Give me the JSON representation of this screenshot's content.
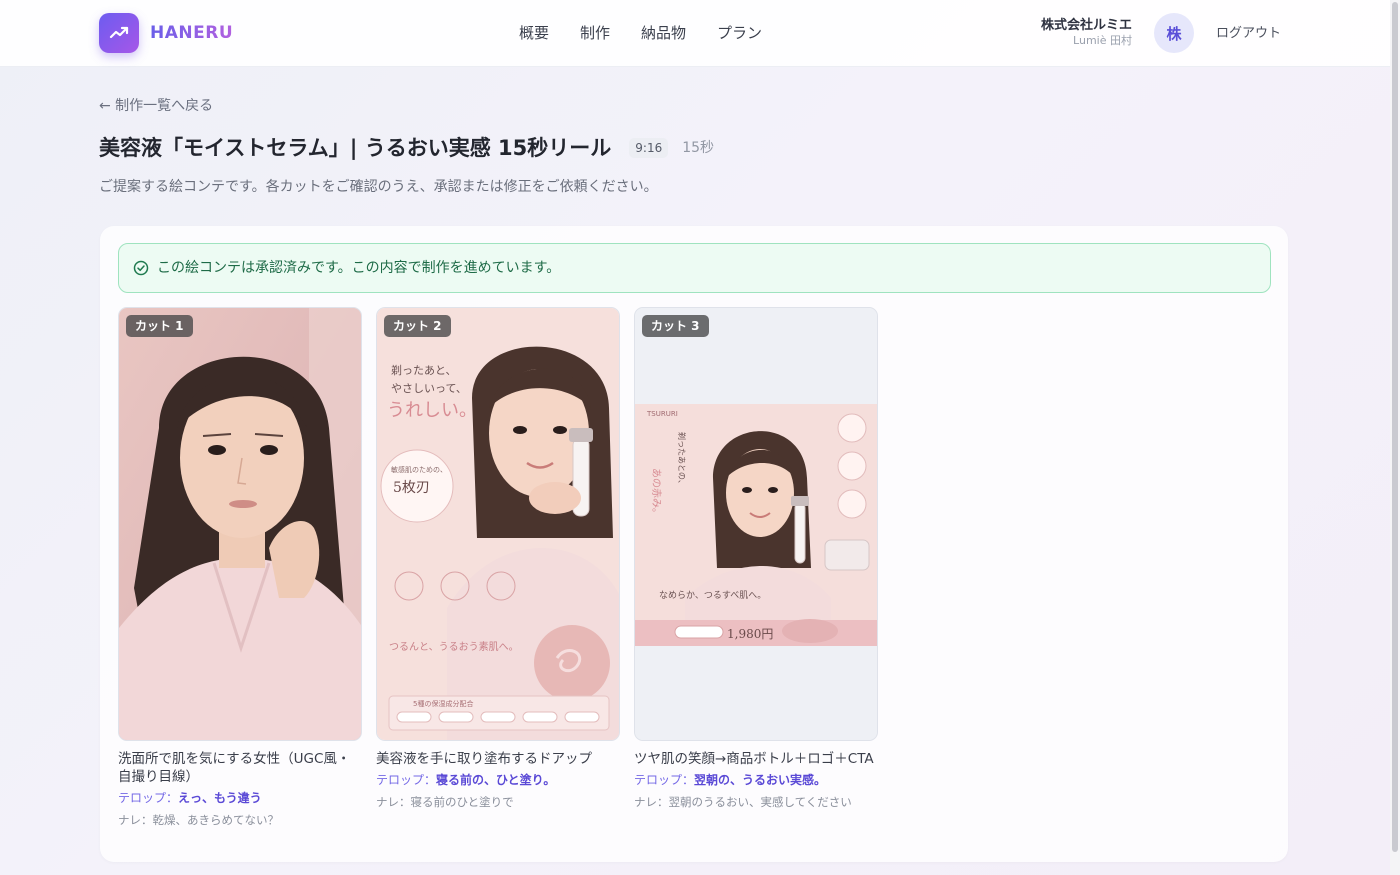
{
  "header": {
    "logo_text": "HANERU",
    "nav": [
      "概要",
      "制作",
      "納品物",
      "プラン"
    ],
    "company_name": "株式会社ルミエ",
    "company_user": "Lumiè 田村",
    "avatar_initial": "株",
    "logout_label": "ログアウト"
  },
  "page": {
    "back_link": "← 制作一覧へ戻る",
    "title": "美容液「モイストセラム」| うるおい実感 15秒リール",
    "ratio": "9:16",
    "duration": "15秒",
    "description": "ご提案する絵コンテです。各カットをご確認のうえ、承認または修正をご依頼ください。"
  },
  "notice": {
    "text": "この絵コンテは承認済みです。この内容で制作を進めています。"
  },
  "cuts": [
    {
      "badge": "カット 1",
      "title": "洗面所で肌を気にする女性（UGC風・自撮り目線）",
      "telop_label": "テロップ：",
      "telop_value": "えっ、もう違う",
      "narration_label": "ナレ：",
      "narration_value": "乾燥、あきらめてない？"
    },
    {
      "badge": "カット 2",
      "title": "美容液を手に取り塗布するドアップ",
      "telop_label": "テロップ：",
      "telop_value": "寝る前の、ひと塗り。",
      "narration_label": "ナレ：",
      "narration_value": "寝る前のひと塗りで",
      "image_text": {
        "headline_1": "剃ったあと、",
        "headline_2": "やさしいって、",
        "headline_3": "うれしい。",
        "circle_top": "敏感肌のための、",
        "circle_main": "5枚刃",
        "copy": "つるんと、うるおう素肌へ。",
        "banner": "5種の保湿成分配合"
      }
    },
    {
      "badge": "カット 3",
      "title": "ツヤ肌の笑顔→商品ボトル＋ロゴ＋CTA",
      "telop_label": "テロップ：",
      "telop_value": "翌朝の、うるおい実感。",
      "narration_label": "ナレ：",
      "narration_value": "翌朝のうるおい、実感してください",
      "image_text": {
        "brand": "TSURURI",
        "vertical_1": "あの赤み。",
        "vertical_2": "剃ったあとの、",
        "copy": "なめらか、つるすべ肌へ。",
        "price": "1,980円"
      }
    }
  ]
}
